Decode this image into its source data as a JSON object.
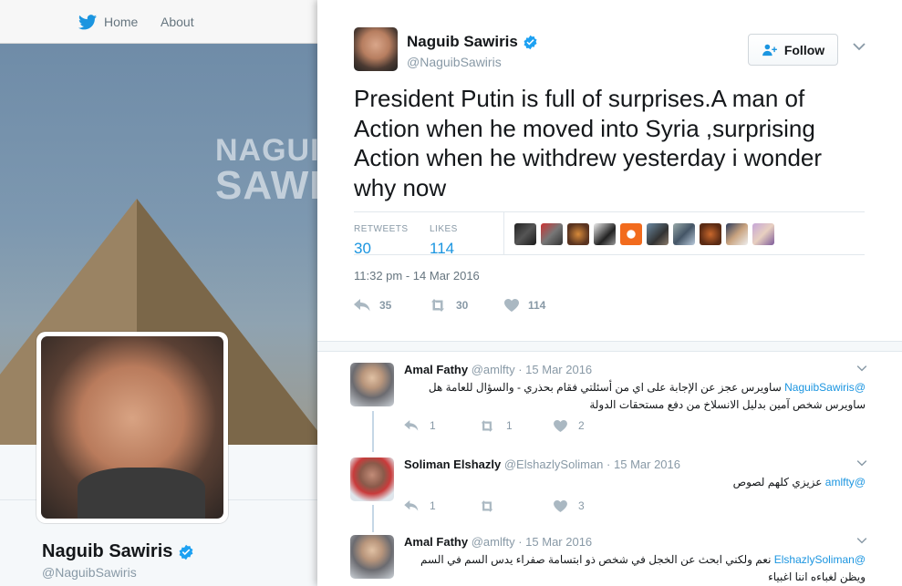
{
  "nav": {
    "home": "Home",
    "about": "About"
  },
  "background_profile": {
    "brand_line1": "NAGUIB",
    "brand_line2": "SAWIRIS",
    "name": "Naguib Sawiris",
    "handle": "@NaguibSawiris"
  },
  "tweet": {
    "author_name": "Naguib Sawiris",
    "author_handle": "@NaguibSawiris",
    "follow_label": "Follow",
    "text": "President Putin is full of surprises.A man of Action when he moved into Syria ,surprising Action when he withdrew yesterday i wonder why now",
    "retweets_label": "RETWEETS",
    "retweets_count": "30",
    "likes_label": "LIKES",
    "likes_count": "114",
    "timestamp": "11:32 pm - 14 Mar 2016",
    "actions": {
      "replies": "35",
      "retweets": "30",
      "likes": "114"
    }
  },
  "replies": [
    {
      "name": "Amal Fathy",
      "handle": "@amlfty",
      "date": "15 Mar 2016",
      "mention": "@NaguibSawiris",
      "text": "ساويرس عجز عن الإجابة على اي من أسئلتي فقام بحذري - والسؤال للعامة هل ساويرس شخص آمين بدليل  الانسلاخ من دفع مستحقات الدولة",
      "reply_count": "1",
      "retweet_count": "1",
      "like_count": "2"
    },
    {
      "name": "Soliman Elshazly",
      "handle": "@ElshazlySoliman",
      "date": "15 Mar 2016",
      "mention": "@amlfty",
      "text": "عزيزي كلهم لصوص",
      "reply_count": "1",
      "retweet_count": "",
      "like_count": "3"
    },
    {
      "name": "Amal Fathy",
      "handle": "@amlfty",
      "date": "15 Mar 2016",
      "mention": "@ElshazlySoliman",
      "text": "نعم ولكني ابحث عن الخجل في شخص ذو ابتسامة صفراء يدس السم في السم ويظن لغباءه اننا اغبياء",
      "reply_count": "",
      "retweet_count": "",
      "like_count": ""
    }
  ],
  "colors": {
    "accent": "#1b95e0",
    "verified": "#1da1f2",
    "muted": "#8899a6"
  },
  "icons": [
    "twitter-bird-icon",
    "verified-badge-icon",
    "follow-person-icon",
    "chevron-down-icon",
    "reply-icon",
    "retweet-icon",
    "heart-icon"
  ]
}
